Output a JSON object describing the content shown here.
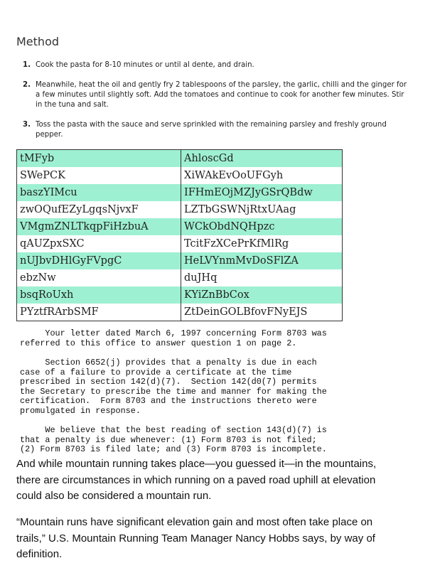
{
  "method": {
    "title": "Method",
    "steps": [
      {
        "num": "1.",
        "text": "Cook the pasta for 8-10 minutes or until al dente, and drain."
      },
      {
        "num": "2.",
        "text": "Meanwhile, heat the oil and gently fry 2 tablespoons of the parsley, the garlic, chilli and the ginger for a few minutes until slightly soft. Add the tomatoes and continue to cook for another few minutes. Stir in the tuna and salt."
      },
      {
        "num": "3.",
        "text": "Toss the pasta with the sauce and serve sprinkled with the remaining parsley and freshly ground pepper."
      }
    ]
  },
  "table": {
    "row_color": "#9ef0d2",
    "rows": [
      [
        "tMFyb",
        "AhloscGd"
      ],
      [
        "SWePCK",
        "XiWAkEvOoUFGyh"
      ],
      [
        "baszYIMcu",
        "IFHmEOjMZJyGSrQBdw"
      ],
      [
        "zwOQufEZyLgqsNjvxF",
        "LZTbGSWNjRtxUAag"
      ],
      [
        "VMgmZNLTkqpFiHzbuA",
        "WCkObdNQHpzc"
      ],
      [
        "qAUZpxSXC",
        "TcitFzXCePrKfMlRg"
      ],
      [
        "nUJbvDHlGyFVpgC",
        "HeLVYnmMvDoSFlZA"
      ],
      [
        "ebzNw",
        "duJHq"
      ],
      [
        "bsqRoUxh",
        "KYiZnBbCox"
      ],
      [
        "PYztfRArbSMF",
        "ZtDeinGOLBfovFNyEJS"
      ]
    ]
  },
  "letter": {
    "p1": "     Your letter dated March 6, 1997 concerning Form 8703 was\nreferred to this office to answer question 1 on page 2.",
    "p2": "     Section 6652(j) provides that a penalty is due in each\ncase of a failure to provide a certificate at the time\nprescribed in section 142(d)(7).  Section 142(d0(7) permits\nthe Secretary to prescribe the time and manner for making the\ncertification.  Form 8703 and the instructions thereto were\npromulgated in response.",
    "p3": "     We believe that the best reading of section 143(d)(7) is\nthat a penalty is due whenever: (1) Form 8703 is not filed;\n(2) Form 8703 is filed late; and (3) Form 8703 is incomplete."
  },
  "article": {
    "p1": "And while mountain running takes place—you guessed it—in the mountains, there are circumstances in which running on a paved road uphill at elevation could also be considered a mountain run.",
    "p2": "“Mountain runs have significant elevation gain and most often take place on trails,” U.S. Mountain Running Team Manager Nancy Hobbs says, by way of definition."
  }
}
